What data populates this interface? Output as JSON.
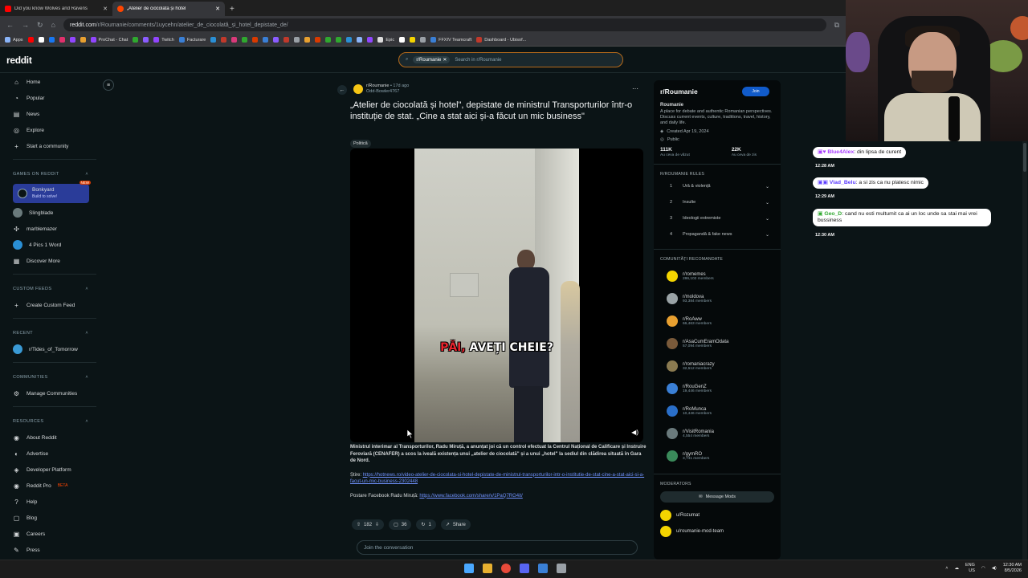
{
  "browser": {
    "tabs": [
      {
        "title": "Did you know Wolves and Ravens",
        "active": false,
        "color": "#ff0000"
      },
      {
        "title": "„Atelier de ciocolată și hotel",
        "active": true,
        "color": "#ff4500"
      }
    ],
    "url_host": "reddit.com",
    "url_path": "/r/Roumanie/comments/1uycehn/atelier_de_ciocolată_și_hotel_depistate_de/",
    "bookmarks": [
      "Apps",
      "ProChat - Chat",
      "Twitch",
      "Facturare",
      "Epic",
      "FFXIV Teamcraft",
      "Dashboard - Ubisof..."
    ]
  },
  "header": {
    "logo": "reddit",
    "search_chip": "r/Roumanie",
    "search_placeholder": "Search in r/Roumanie"
  },
  "left_nav": {
    "main": [
      "Home",
      "Popular",
      "News",
      "Explore",
      "Start a community"
    ],
    "games_header": "GAMES ON REDDIT",
    "games": [
      {
        "name": "Bonkyard",
        "sub": "Build to solve!",
        "badge": "NEW"
      },
      {
        "name": "Slingblade"
      },
      {
        "name": "marblemazer"
      },
      {
        "name": "4 Pics 1 Word"
      },
      {
        "name": "Discover More"
      }
    ],
    "custom_header": "CUSTOM FEEDS",
    "custom_item": "Create Custom Feed",
    "recent_header": "RECENT",
    "recent_item": "r/Tides_of_Tomorrow",
    "communities_header": "COMMUNITIES",
    "communities_item": "Manage Communities",
    "resources_header": "RESOURCES",
    "resources": [
      "About Reddit",
      "Advertise",
      "Developer Platform",
      "Reddit Pro",
      "Help",
      "Blog",
      "Careers",
      "Press"
    ],
    "reddit_pro_badge": "BETA"
  },
  "post": {
    "subreddit": "r/Roumanie",
    "age": "• 17d ago",
    "author": "Odd-Bowler4767",
    "title": "„Atelier de ciocolată și hotel\", depistate de ministrul Transporturilor într-o instituție de stat. „Cine a stat aici și-a făcut un mic business\"",
    "flair": "Politică",
    "video_caption_red": "PĂI,",
    "video_caption_white": " AVEȚI CHEIE?",
    "body_bold": "Ministrul interimar al Transporturilor, Radu Miruță, a anunțat joi că un control efectuat la Centrul Național de Calificare și Instruire Feroviară (CENAFER) a scos la iveală existența unui „atelier de ciocolată\" și a unui „hotel\" la sediul din clădirea situată în Gara de Nord.",
    "source_label": "Știre: ",
    "source_link": "https://hotnews.ro/video-atelier-de-ciocolata-si-hotel-depistate-de-ministrul-transporturilor-intr-o-institutie-de-stat-cine-a-stat-aici-si-a-facut-un-mic-business-2302448",
    "fb_label": "Postare Facebook Radu Miruță: ",
    "fb_link": "https://www.facebook.com/share/v/1PaQ7RG4it/",
    "votes": "182",
    "comments": "36",
    "crossposts": "1",
    "share": "Share",
    "join_placeholder": "Join the conversation"
  },
  "right_sidebar": {
    "name": "r/Roumanie",
    "join_label": "Join",
    "title": "Roumanie",
    "description": "A place for debate and authentic Romanian perspectives. Discuss current events, culture, traditions, travel, history, and daily life.",
    "created": "Created Apr 19, 2024",
    "visibility": "Public",
    "stat1_value": "111K",
    "stat1_label": "Au ceva de văzut",
    "stat2_value": "22K",
    "stat2_label": "Au ceva de zis",
    "rules_header": "R/ROUMANIE RULES",
    "rules": [
      {
        "n": "1",
        "t": "Ură & violență"
      },
      {
        "n": "2",
        "t": "Insulte"
      },
      {
        "n": "3",
        "t": "Ideologii extremiste"
      },
      {
        "n": "4",
        "t": "Propagandă & fake news"
      }
    ],
    "recommended_header": "COMUNITĂȚI RECOMANDATE",
    "communities": [
      {
        "name": "r/romemes",
        "members": "286,102 members",
        "color": "#f4d400"
      },
      {
        "name": "r/moldova",
        "members": "93,384 members",
        "color": "#9aa3a6"
      },
      {
        "name": "r/RoAww",
        "members": "66,463 members",
        "color": "#e8a030"
      },
      {
        "name": "r/AsaCumEramOdata",
        "members": "57,094 members",
        "color": "#7a5a3a"
      },
      {
        "name": "r/romaniacrazy",
        "members": "32,512 members",
        "color": "#8a7a50"
      },
      {
        "name": "r/RouGenZ",
        "members": "19,446 members",
        "color": "#3a7fd5"
      },
      {
        "name": "r/RoMunca",
        "members": "10,446 members",
        "color": "#2a6fc9"
      },
      {
        "name": "r/VisitRomania",
        "members": "4,554 members",
        "color": "#6a7a7c"
      },
      {
        "name": "r/gymRO",
        "members": "3,741 members",
        "color": "#3a8a5a"
      }
    ],
    "moderators_header": "MODERATORS",
    "message_mods": "Message Mods",
    "mods": [
      {
        "name": "u/Rozumat",
        "color": "#f4d400"
      },
      {
        "name": "u/roumanie-mod-team",
        "color": "#f4d400"
      }
    ]
  },
  "stream_chat": [
    {
      "user": "Blue4Alex",
      "text": ": din lipsa de curent",
      "time": "12:28 AM",
      "user_color": "#a83cff"
    },
    {
      "user": "Vlad_Belu",
      "text": ": a si zis ca nu platesc nimic",
      "time": "12:29 AM",
      "user_color": "#5b3cff"
    },
    {
      "user": "Geo_D",
      "text": ": cand nu esti multumit ca ai un loc unde sa stai mai vrei bussiness",
      "time": "12:30 AM",
      "user_color": "#2fa82f"
    }
  ],
  "taskbar": {
    "lang_top": "ENG",
    "lang_bottom": "US",
    "time": "12:30 AM",
    "date": "8/5/2026"
  }
}
